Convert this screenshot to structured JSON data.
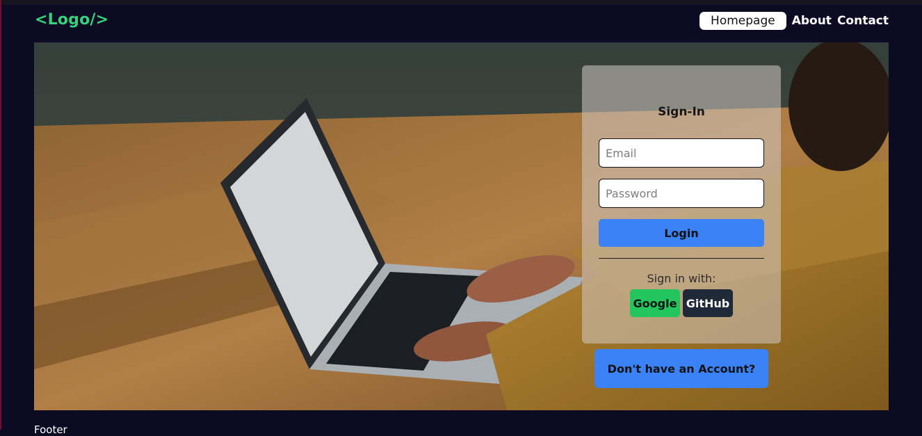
{
  "header": {
    "logo": "<Logo/>",
    "nav": [
      "Homepage",
      "About",
      "Contact"
    ]
  },
  "signin": {
    "title": "Sign-In",
    "email_placeholder": "Email",
    "password_placeholder": "Password",
    "login_label": "Login",
    "sign_in_with": "Sign in with:",
    "google_label": "Google",
    "github_label": "GitHub"
  },
  "account_button": "Don't have an Account?",
  "footer": "Footer",
  "colors": {
    "background": "#0d0b24",
    "logo": "#34d27a",
    "primary": "#3b82f6",
    "google": "#22c55e",
    "github": "#1f2937"
  },
  "icons": {
    "hero": "photo-laptop-typing"
  }
}
